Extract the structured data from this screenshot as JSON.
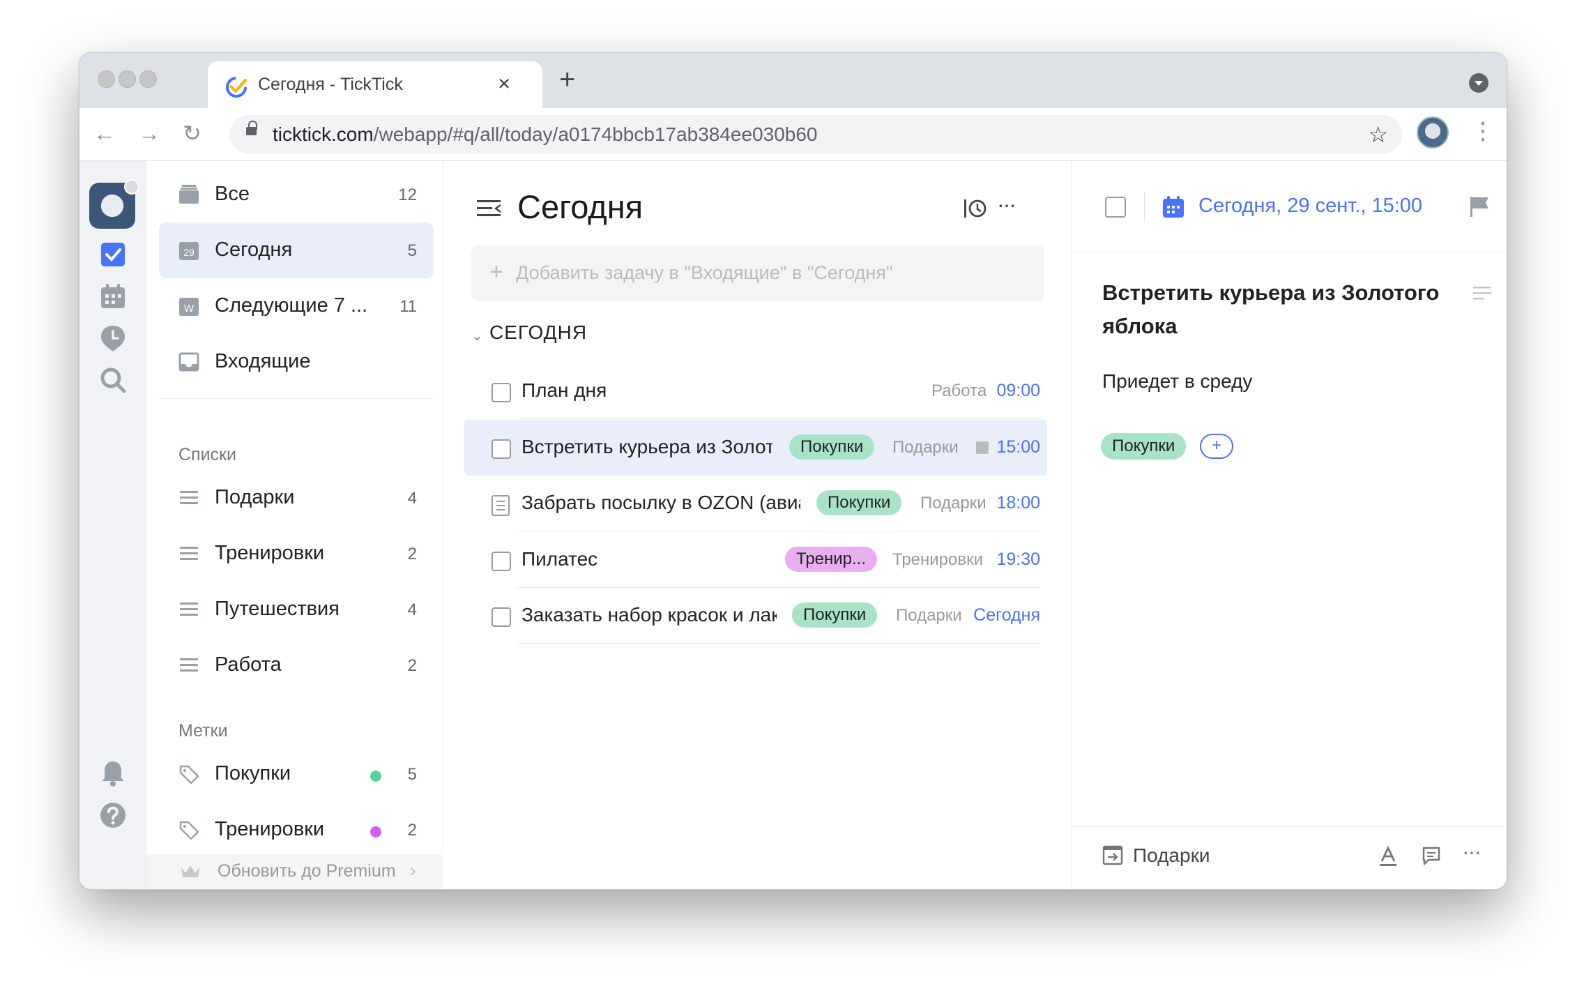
{
  "browser": {
    "tab_title": "Сегодня - TickTick",
    "tab_close": "×",
    "new_tab": "+",
    "url_host": "ticktick.com",
    "url_path": "/webapp/#q/all/today/a0174bbcb17ab384ee030b60",
    "nav": {
      "back": "←",
      "forward": "→",
      "reload": "↻"
    },
    "bookmark": "☆",
    "menu": "⋮"
  },
  "rail": {
    "icons": [
      "avatar",
      "checkbox-icon",
      "calendar-icon",
      "pomodoro-icon",
      "search-icon",
      "bell-icon",
      "help-icon"
    ]
  },
  "sidebar": {
    "smart_lists": [
      {
        "label": "Все",
        "count": "12",
        "icon": "inbox-stack-icon"
      },
      {
        "label": "Сегодня",
        "count": "5",
        "icon": "calendar-day-icon",
        "active": true,
        "badge": "29"
      },
      {
        "label": "Следующие 7 ...",
        "count": "11",
        "icon": "calendar-week-icon",
        "badge": "W"
      },
      {
        "label": "Входящие",
        "count": "",
        "icon": "inbox-icon"
      }
    ],
    "lists_title": "Списки",
    "lists": [
      {
        "label": "Подарки",
        "count": "4"
      },
      {
        "label": "Тренировки",
        "count": "2"
      },
      {
        "label": "Путешествия",
        "count": "4"
      },
      {
        "label": "Работа",
        "count": "2"
      }
    ],
    "tags_title": "Метки",
    "tags": [
      {
        "label": "Покупки",
        "count": "5",
        "color": "#5ccfa0"
      },
      {
        "label": "Тренировки",
        "count": "2",
        "color": "#d15ef0"
      }
    ],
    "premium": "Обновить до Premium",
    "premium_chevron": "›"
  },
  "main": {
    "title": "Сегодня",
    "add_placeholder": "Добавить задачу в \"Входящие\" в \"Сегодня\"",
    "add_plus": "+",
    "more": "···",
    "group_title": "СЕГОДНЯ",
    "group_chevron": "⌄",
    "tasks": [
      {
        "title": "План дня",
        "tag": "",
        "list": "Работа",
        "time": "09:00"
      },
      {
        "title": "Встретить курьера из Золотого яблока",
        "tag": "Покупки",
        "list": "Подарки",
        "time": "15:00",
        "selected": true,
        "has_note": true
      },
      {
        "title": "Забрать посылку в OZON (авиапарк)",
        "tag": "Покупки",
        "list": "Подарки",
        "time": "18:00",
        "note_icon": true
      },
      {
        "title": "Пилатес",
        "tag": "Тренир...",
        "list": "Тренировки",
        "time": "19:30"
      },
      {
        "title": "Заказать набор красок и лак",
        "tag": "Покупки",
        "list": "Подарки",
        "time": "Сегодня"
      }
    ],
    "colors": {
      "accent": "#4772fa",
      "tag_green": "#a8e3c8",
      "tag_purple": "#e9aef0",
      "selected_row": "#eaeefb"
    }
  },
  "detail": {
    "date": "Сегодня, 29 сент., 15:00",
    "title": "Встретить курьера из Золотого яблока",
    "description": "Приедет в среду",
    "tag": "Покупки",
    "add_tag": "+",
    "project": "Подарки",
    "more": "···"
  }
}
